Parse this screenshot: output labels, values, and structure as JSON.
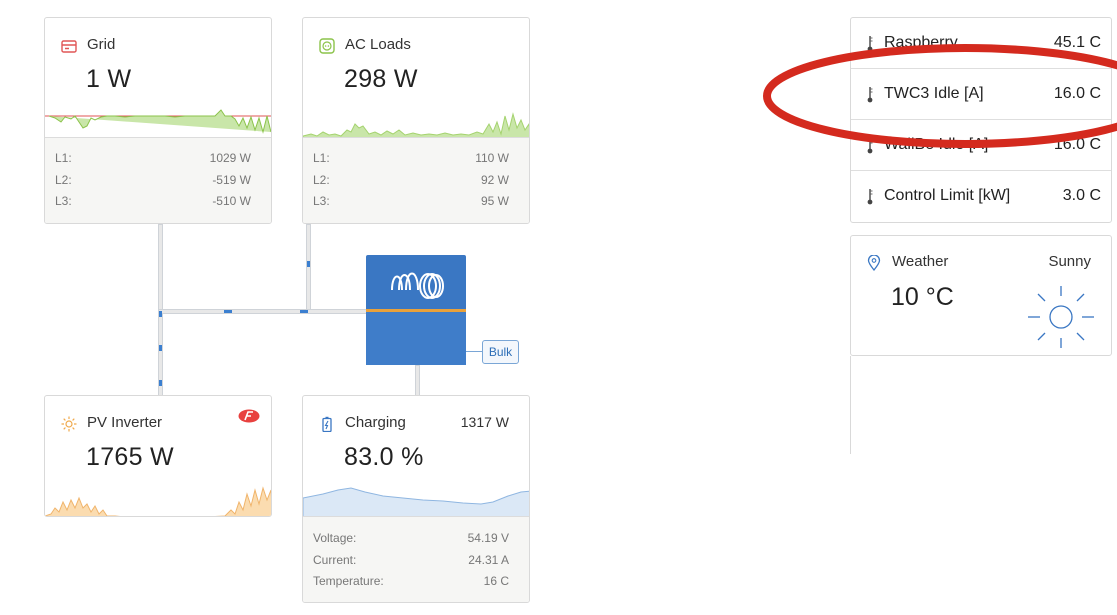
{
  "grid": {
    "title": "Grid",
    "value": "1 W",
    "phases": [
      {
        "label": "L1:",
        "value": "1029 W"
      },
      {
        "label": "L2:",
        "value": "-519 W"
      },
      {
        "label": "L3:",
        "value": "-510 W"
      }
    ]
  },
  "ac_loads": {
    "title": "AC Loads",
    "value": "298 W",
    "phases": [
      {
        "label": "L1:",
        "value": "110 W"
      },
      {
        "label": "L2:",
        "value": "92 W"
      },
      {
        "label": "L3:",
        "value": "95 W"
      }
    ]
  },
  "pv_inverter": {
    "title": "PV Inverter",
    "value": "1765 W"
  },
  "battery": {
    "title": "Charging",
    "power": "1317 W",
    "value": "83.0 %",
    "details": [
      {
        "label": "Voltage:",
        "value": "54.19 V"
      },
      {
        "label": "Current:",
        "value": "24.31 A"
      },
      {
        "label": "Temperature:",
        "value": "16 C"
      }
    ]
  },
  "inverter": {
    "state": "Bulk"
  },
  "sensors": [
    {
      "label": "Raspberry",
      "value": "45.1 C"
    },
    {
      "label": "TWC3 Idle [A]",
      "value": "16.0 C"
    },
    {
      "label": "WallBe Idle [A]",
      "value": "16.0 C"
    },
    {
      "label": "Control Limit [kW]",
      "value": "3.0 C"
    }
  ],
  "weather": {
    "title": "Weather",
    "condition": "Sunny",
    "temperature": "10 °C"
  },
  "colors": {
    "victron_blue": "#3a77c3",
    "orange": "#e9a13b",
    "annotation_red": "#d42a1e",
    "grid_red": "#e05656",
    "loads_green": "#8bc34a",
    "pv_orange": "#f0a94b",
    "battery_blue": "#4a89d0"
  }
}
